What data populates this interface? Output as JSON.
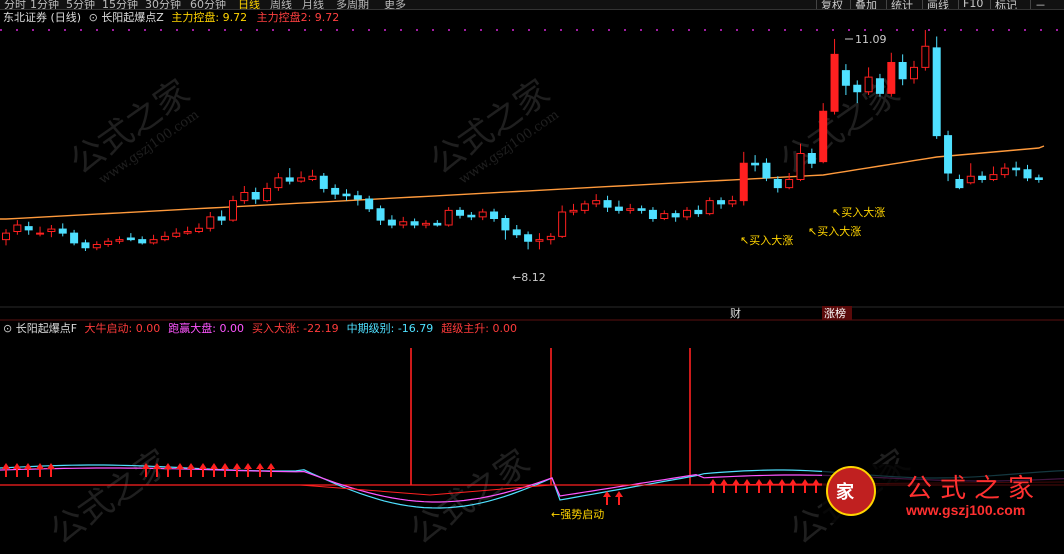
{
  "toolbar": {
    "left_items": [
      "分时",
      "1分钟",
      "5分钟",
      "15分钟",
      "30分钟",
      "60分钟",
      "日线",
      "周线",
      "月线",
      "多周期",
      "更多"
    ],
    "active_item": "日线",
    "right_buttons": [
      "复权",
      "叠加",
      "统计",
      "画线",
      "F10",
      "标记",
      "－"
    ]
  },
  "main_panel": {
    "security": "东北证券 (日线)",
    "indicator_name": "长阳起爆点Z",
    "line1_label": "主力控盘:",
    "line1_value": "9.72",
    "line2_label": "主力控盘2:",
    "line2_value": "9.72",
    "high_label": "11.09",
    "low_label": "8.12",
    "signal_label": "买入大涨",
    "event_cai": "财",
    "event_zhangbang": "涨榜"
  },
  "sub_panel": {
    "indicator_name": "长阳起爆点F",
    "items": [
      {
        "label": "大牛启动:",
        "value": "0.00",
        "color": "#ff3b3b"
      },
      {
        "label": "跑赢大盘:",
        "value": "0.00",
        "color": "#ff55ff"
      },
      {
        "label": "买入大涨:",
        "value": "-22.19",
        "color": "#ff3b3b"
      },
      {
        "label": "中期级别:",
        "value": "-16.79",
        "color": "#4fe0ff"
      },
      {
        "label": "超级主升:",
        "value": "0.00",
        "color": "#ff3b3b"
      }
    ],
    "bottom_label": "强势启动"
  },
  "watermark": {
    "text1": "公式之家",
    "text2": "www.gszj100.com",
    "logo_text": "公式之家",
    "logo_url": "www.gszj100.com"
  },
  "colors": {
    "up": "#ff2020",
    "down": "#4fe0ff",
    "ma": "#ff9a3c",
    "signal": "#ffd400"
  }
}
